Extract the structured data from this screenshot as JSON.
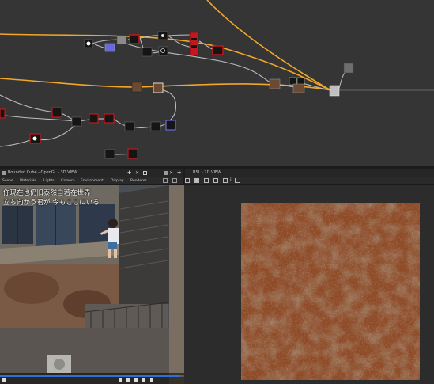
{
  "colors": {
    "graph_bg": "#353535",
    "wire_orange": "#f2a62a",
    "wire_gray": "#bdbdbd",
    "node_red": "#c4161c",
    "node_dark": "#151515",
    "node_purple": "#6b69d6",
    "node_gray": "#8b8b8b",
    "node_brown": "#6b4a33",
    "rust": "#8e4b28",
    "video_progress": "#2f6fd6"
  },
  "panel_3d": {
    "title": "Rounded Cube - OpenGL - 3D VIEW",
    "menu": [
      "Scene",
      "Materials",
      "Lights",
      "Camera",
      "Environment",
      "Display",
      "Renderer"
    ]
  },
  "panel_2d": {
    "title": "RSL - 2D VIEW"
  },
  "video": {
    "subtitle_line1": "你现在也仍旧泰然自若在世界",
    "subtitle_line2": "立ち向かう君が 今もここにいる",
    "progress": 0.98
  },
  "icons": {
    "graph": "node-graph",
    "toolbar": [
      "close-icon",
      "pin-icon",
      "maximize-icon",
      "settings-icon"
    ]
  }
}
